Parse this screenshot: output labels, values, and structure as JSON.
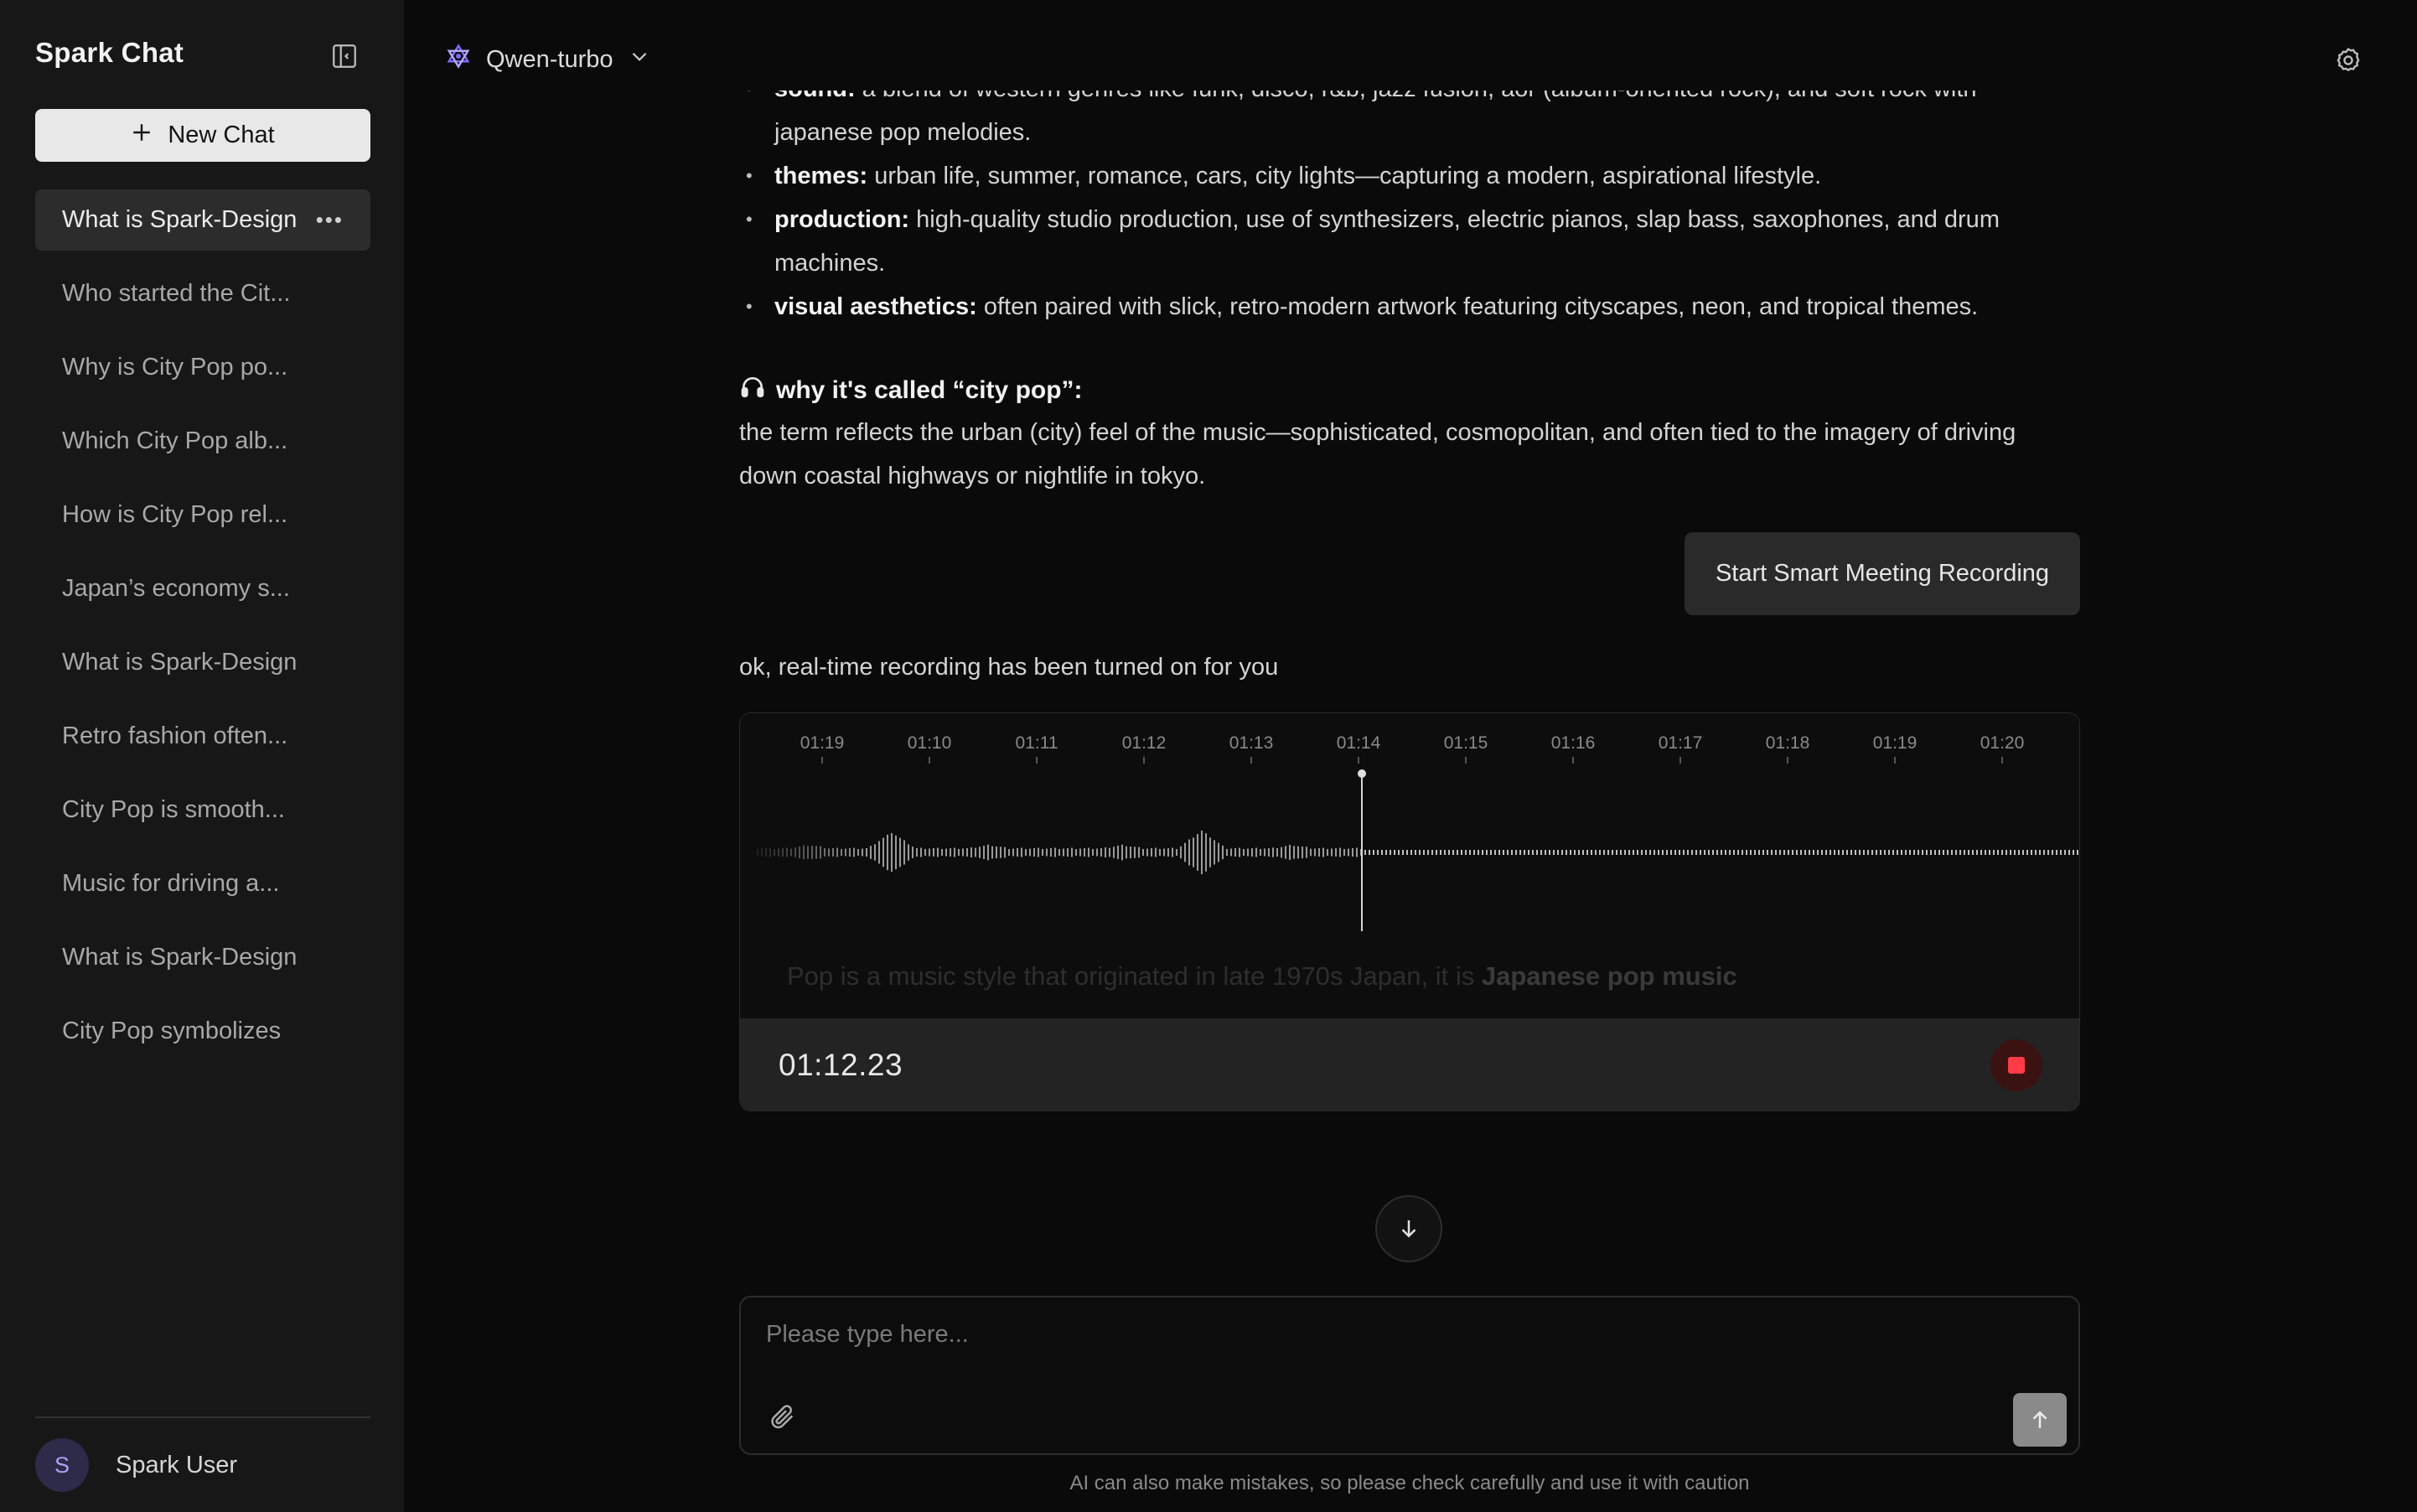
{
  "sidebar": {
    "app_title": "Spark Chat",
    "new_chat_label": "New Chat",
    "chats": [
      "What is Spark-Design",
      "Who started the Cit...",
      "Why is City Pop po...",
      "Which City Pop alb...",
      "How is City Pop rel...",
      "Japan’s economy s...",
      "What is Spark-Design",
      "Retro fashion often...",
      "City Pop is smooth...",
      "Music for driving a...",
      "What is Spark-Design",
      "City Pop symbolizes"
    ],
    "active_index": 0,
    "user": {
      "initial": "S",
      "name": "Spark User"
    }
  },
  "header": {
    "model_name": "Qwen-turbo"
  },
  "conversation": {
    "bullets": [
      {
        "label": "sound:",
        "text": " a blend of western genres like funk, disco, r&b, jazz fusion, aor (album-oriented rock), and soft rock with japanese pop melodies."
      },
      {
        "label": "themes:",
        "text": " urban life, summer, romance, cars, city lights—capturing a modern, aspirational lifestyle."
      },
      {
        "label": "production:",
        "text": " high-quality studio production, use of synthesizers, electric pianos, slap bass, saxophones, and drum machines."
      },
      {
        "label": "visual aesthetics:",
        "text": " often paired with slick, retro-modern artwork featuring cityscapes, neon, and tropical themes."
      }
    ],
    "heading_icon": "headphones-icon",
    "heading": "why it's called “city pop”:",
    "paragraph": "the term reflects the urban (city) feel of the music—sophisticated, cosmopolitan, and often tied to the imagery of driving down coastal highways or nightlife in tokyo.",
    "user_message": "Start Smart Meeting Recording",
    "ai_reply": "ok, real-time recording has been turned on for you"
  },
  "recorder": {
    "timeline_labels": [
      "01:19",
      "01:10",
      "01:11",
      "01:12",
      "01:13",
      "01:14",
      "01:15",
      "01:16",
      "01:17",
      "01:18",
      "01:19",
      "01:20"
    ],
    "transcript_prefix": "Pop is a music style that originated in late 1970s Japan, it is ",
    "transcript_bold": "Japanese pop music",
    "elapsed": "01:12.23",
    "stop_color": "#ff3b47"
  },
  "input": {
    "placeholder": "Please type here...",
    "disclaimer": "AI can also make mistakes, so please check carefully and use it with caution"
  },
  "colors": {
    "background": "#0a0a0a",
    "sidebar": "#171717",
    "accent_logo": "#7b6cf6"
  }
}
